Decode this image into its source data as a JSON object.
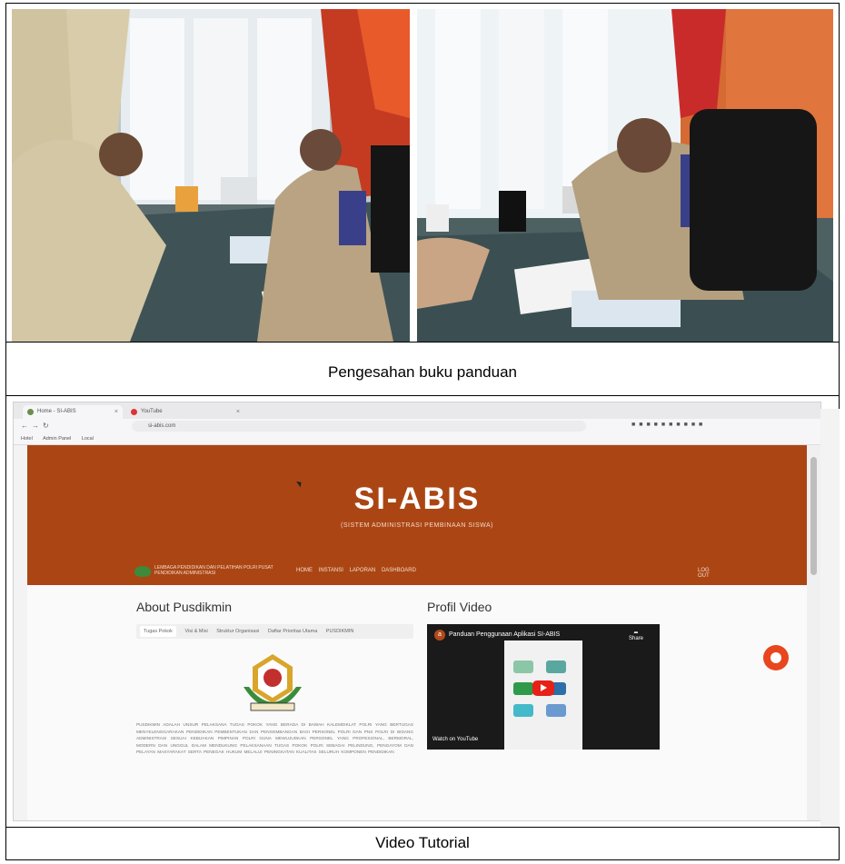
{
  "captions": {
    "top": "Pengesahan buku panduan",
    "bottom": "Video Tutorial"
  },
  "photos": [
    {
      "name": "signing-photo-left"
    },
    {
      "name": "signing-photo-right"
    }
  ],
  "browser": {
    "tabs": [
      "Home - SI-ABIS",
      "YouTube"
    ],
    "url": "si-abis.com",
    "bookmarks": [
      "Hotel",
      "Admin Panel",
      "Local"
    ]
  },
  "site": {
    "title": "SI-ABIS",
    "subtitle": "(SISTEM ADMINISTRASI PEMBINAAN SISWA)",
    "org_name": "LEMBAGA PENDIDIKAN DAN PELATIHAN POLRI PUSAT PENDIDIKAN ADMINISTRASI",
    "menu": [
      "HOME",
      "INSTANSI",
      "LAPORAN",
      "DASHBOARD"
    ],
    "logout": "LOG OUT",
    "about_title": "About Pusdikmin",
    "about_tabs": [
      "Tugas Pokok",
      "Visi & Misi",
      "Struktur Organisasi",
      "Daftar Prioritas Utama",
      "PUSDIKMIN"
    ],
    "about_text": "PUSDIKMIN ADALAH UNSUR PELAKSANA TUGAS POKOK YANG BERADA DI BAWAH KALEMDIKLAT POLRI YANG BERTUGAS MENYELENGGARAKAN PENDIDIKAN PEMBENTUKAN DAN PENGEMBANGAN BAGI PERSONEL POLRI DAN PNS POLRI DI BIDANG ADMINISTRASI SESUAI KEBIJAKAN PIMPINAN POLRI GUNA MEWUJUDKAN PERSONEL YANG PROFESIONAL, BERMORAL, MODERN DAN UNGGUL DALAM MENDUKUNG PELAKSANAAN TUGAS POKOK POLRI SEBAGAI PELINDUNG, PENGAYOM DAN PELAYAN MASYARAKAT SERTA PENEGAK HUKUM MELALUI PENINGKATAN KUALITAS SELURUH KOMPONEN PENDIDIKAN",
    "profil_title": "Profil Video",
    "video_title": "Panduan Penggunaan Aplikasi SI-ABIS",
    "video_channel_initial": "a",
    "share_label": "Share",
    "watch_label": "Watch on YouTube"
  },
  "colors": {
    "hero": "#ab4614",
    "play": "#e62117"
  }
}
